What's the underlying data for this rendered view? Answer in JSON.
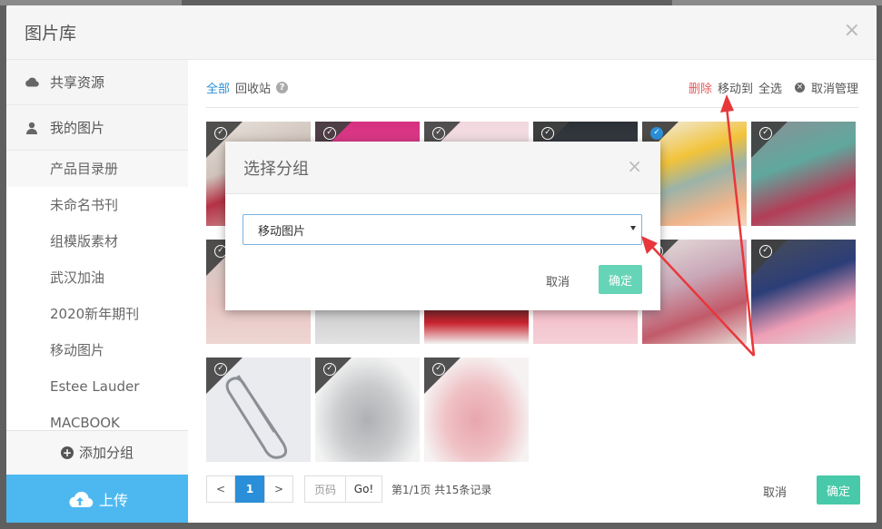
{
  "dialog": {
    "title": "图片库",
    "close": "×"
  },
  "sidebar": {
    "shared": "共享资源",
    "mine": "我的图片",
    "groups": [
      "产品目录册",
      "未命名书刊",
      "组模版素材",
      "武汉加油",
      "2020新年期刊",
      "移动图片",
      "Estee Lauder",
      "MACBOOK"
    ],
    "add_group": "添加分组",
    "upload": "上传"
  },
  "toolbar": {
    "all": "全部",
    "recycle": "回收站",
    "help": "?",
    "delete": "删除",
    "move_to": "移动到",
    "select_all": "全选",
    "cancel_manage": "取消管理"
  },
  "pagination": {
    "prev": "<",
    "current": "1",
    "next": ">",
    "page_placeholder": "页码",
    "go": "Go!",
    "info": "第1/1页 共15条记录"
  },
  "footer": {
    "cancel": "取消",
    "ok": "确定"
  },
  "submodal": {
    "title": "选择分组",
    "close": "×",
    "selected_group": "移动图片",
    "cancel": "取消",
    "ok": "确定"
  },
  "colors": {
    "accent": "#2a8fd8",
    "confirm": "#48c9a9",
    "danger": "#e35b5b",
    "upload": "#4db8f0",
    "annotation_arrow": "#e8373b"
  }
}
